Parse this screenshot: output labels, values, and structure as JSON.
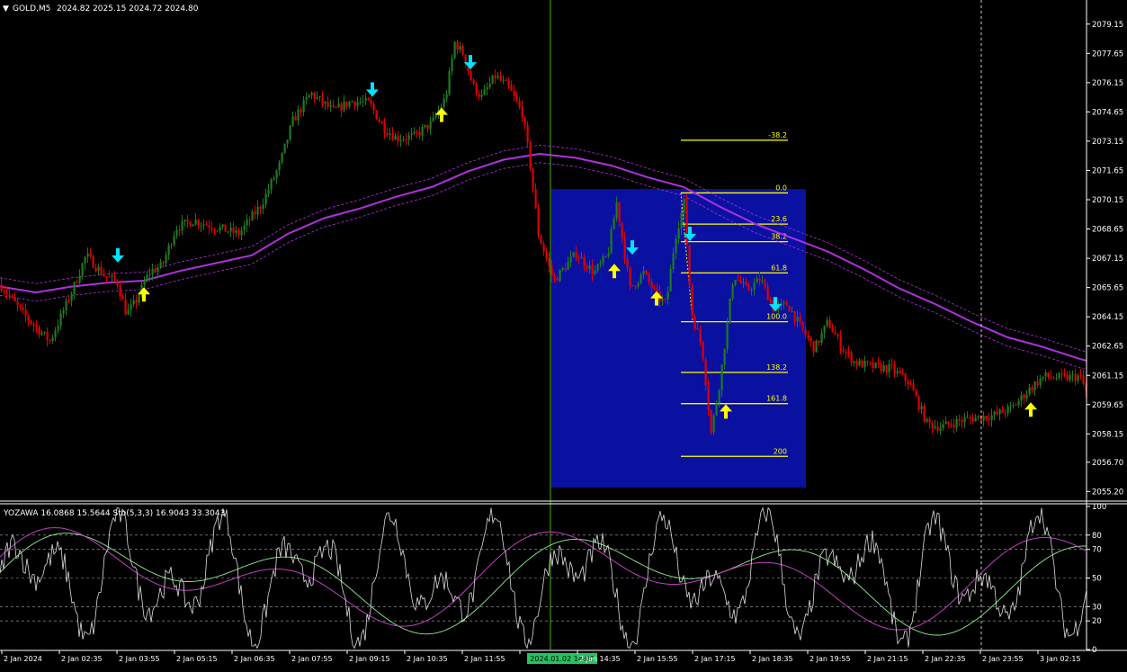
{
  "header": {
    "symbol": "GOLD,M5",
    "ohlc": "2024.82 2025.15 2024.72 2024.80"
  },
  "subwindow": {
    "label": "YOZAWA 16.0868 15.5644  Sto(5,3,3) 16.9043 33.3043"
  },
  "colors": {
    "background": "#000000",
    "bull": "#1f7a1f",
    "bear": "#e00000",
    "ma": "#b030e0",
    "fibo_box": "#0a10a0",
    "fibo_line": "#ffff00",
    "arrow_up": "#ffff00",
    "arrow_down": "#00e5ff",
    "vline": "#4caf20",
    "stoch_main": "#dddddd",
    "stoch_signal": "#c040c0",
    "stoch_yozawa": "#90ee90"
  },
  "chart_data": [
    {
      "type": "bar",
      "name": "price",
      "ylim": [
        2054.8,
        2080.2
      ],
      "y_ticks": [
        "2079.15",
        "2077.65",
        "2076.15",
        "2074.65",
        "2073.15",
        "2071.65",
        "2070.15",
        "2068.65",
        "2067.15",
        "2065.65",
        "2064.15",
        "2062.65",
        "2061.15",
        "2059.65",
        "2058.15",
        "2056.70",
        "2055.20"
      ],
      "x_ticks": [
        "2 Jan 2024",
        "2 Jan 02:35",
        "2 Jan 03:55",
        "2 Jan 05:15",
        "2 Jan 06:35",
        "2 Jan 07:55",
        "2 Jan 09:15",
        "2 Jan 10:35",
        "2 Jan 11:55",
        "2024.01.02 14:00",
        "2 Jan 14:35",
        "2 Jan 15:55",
        "2 Jan 17:15",
        "2 Jan 18:35",
        "2 Jan 19:55",
        "2 Jan 21:15",
        "2 Jan 22:35",
        "2 Jan 23:55",
        "3 Jan 02:15"
      ],
      "highlighted_x_tick": "2024.01.02 14:00",
      "fibo_levels": [
        "-38.2",
        "0.0",
        "23.6",
        "38.2",
        "61.8",
        "100.0",
        "138.2",
        "161.8",
        "200"
      ],
      "fibo_values": [
        2073.2,
        2070.5,
        2068.9,
        2068.0,
        2066.4,
        2063.9,
        2061.3,
        2059.7,
        2057.0
      ],
      "ma_control": [
        [
          0,
          2065.7
        ],
        [
          40,
          2065.4
        ],
        [
          80,
          2065.7
        ],
        [
          120,
          2065.9
        ],
        [
          160,
          2066.0
        ],
        [
          200,
          2066.5
        ],
        [
          240,
          2066.9
        ],
        [
          280,
          2067.3
        ],
        [
          320,
          2068.4
        ],
        [
          360,
          2069.2
        ],
        [
          400,
          2069.7
        ],
        [
          440,
          2070.3
        ],
        [
          480,
          2070.8
        ],
        [
          520,
          2071.6
        ],
        [
          560,
          2072.2
        ],
        [
          600,
          2072.5
        ],
        [
          640,
          2072.3
        ],
        [
          680,
          2071.9
        ],
        [
          720,
          2071.3
        ],
        [
          760,
          2070.8
        ],
        [
          800,
          2069.8
        ],
        [
          840,
          2068.9
        ],
        [
          880,
          2068.2
        ],
        [
          920,
          2067.5
        ],
        [
          960,
          2066.6
        ],
        [
          1000,
          2065.6
        ],
        [
          1040,
          2064.8
        ],
        [
          1080,
          2063.9
        ],
        [
          1120,
          2063.1
        ],
        [
          1160,
          2062.6
        ],
        [
          1200,
          2062.0
        ],
        [
          1208,
          2061.9
        ]
      ],
      "price_control": [
        [
          0,
          2065.8
        ],
        [
          25,
          2064.3
        ],
        [
          55,
          2062.9
        ],
        [
          80,
          2065.5
        ],
        [
          95,
          2067.3
        ],
        [
          115,
          2066.3
        ],
        [
          130,
          2065.9
        ],
        [
          140,
          2064.3
        ],
        [
          150,
          2064.9
        ],
        [
          165,
          2066.4
        ],
        [
          180,
          2066.8
        ],
        [
          195,
          2068.7
        ],
        [
          215,
          2069.1
        ],
        [
          235,
          2068.8
        ],
        [
          265,
          2068.4
        ],
        [
          290,
          2069.9
        ],
        [
          310,
          2071.9
        ],
        [
          325,
          2074.2
        ],
        [
          345,
          2075.6
        ],
        [
          370,
          2074.7
        ],
        [
          390,
          2075.2
        ],
        [
          410,
          2075.1
        ],
        [
          425,
          2073.9
        ],
        [
          440,
          2073.3
        ],
        [
          460,
          2073.4
        ],
        [
          480,
          2074.1
        ],
        [
          495,
          2075.4
        ],
        [
          505,
          2078.2
        ],
        [
          515,
          2077.6
        ],
        [
          525,
          2076.0
        ],
        [
          535,
          2075.4
        ],
        [
          550,
          2076.5
        ],
        [
          565,
          2075.9
        ],
        [
          580,
          2074.6
        ],
        [
          588,
          2072.3
        ],
        [
          598,
          2068.4
        ],
        [
          615,
          2066.0
        ],
        [
          640,
          2067.4
        ],
        [
          660,
          2066.4
        ],
        [
          675,
          2067.3
        ],
        [
          685,
          2070.0
        ],
        [
          700,
          2065.6
        ],
        [
          715,
          2066.4
        ],
        [
          730,
          2065.2
        ],
        [
          740,
          2064.8
        ],
        [
          750,
          2068.2
        ],
        [
          760,
          2070.0
        ],
        [
          768,
          2064.4
        ],
        [
          780,
          2062.6
        ],
        [
          790,
          2058.2
        ],
        [
          800,
          2060.9
        ],
        [
          815,
          2066.3
        ],
        [
          830,
          2065.5
        ],
        [
          845,
          2066.1
        ],
        [
          860,
          2064.5
        ],
        [
          875,
          2064.8
        ],
        [
          890,
          2063.6
        ],
        [
          905,
          2062.5
        ],
        [
          920,
          2063.9
        ],
        [
          935,
          2062.6
        ],
        [
          950,
          2061.8
        ],
        [
          970,
          2061.6
        ],
        [
          990,
          2061.5
        ],
        [
          1010,
          2060.8
        ],
        [
          1030,
          2058.7
        ],
        [
          1045,
          2058.5
        ],
        [
          1065,
          2058.8
        ],
        [
          1085,
          2059.0
        ],
        [
          1105,
          2059.1
        ],
        [
          1125,
          2059.5
        ],
        [
          1145,
          2060.5
        ],
        [
          1160,
          2061.1
        ],
        [
          1180,
          2061.0
        ],
        [
          1200,
          2061.1
        ],
        [
          1208,
          2060.2
        ]
      ],
      "arrows_up": [
        [
          160,
          2065.3
        ],
        [
          491,
          2074.5
        ],
        [
          683,
          2066.5
        ],
        [
          730,
          2065.1
        ],
        [
          807,
          2059.3
        ],
        [
          1146,
          2059.4
        ]
      ],
      "arrows_down": [
        [
          131,
          2067.3
        ],
        [
          414,
          2075.8
        ],
        [
          523,
          2077.2
        ],
        [
          703,
          2067.7
        ],
        [
          767,
          2068.4
        ],
        [
          862,
          2064.8
        ]
      ]
    },
    {
      "type": "line",
      "name": "stochastic",
      "ylim": [
        0,
        100
      ],
      "y_ticks": [
        "100",
        "80",
        "70",
        "50",
        "30",
        "20",
        "0"
      ],
      "levels": [
        80,
        70,
        50,
        30,
        20
      ]
    }
  ]
}
